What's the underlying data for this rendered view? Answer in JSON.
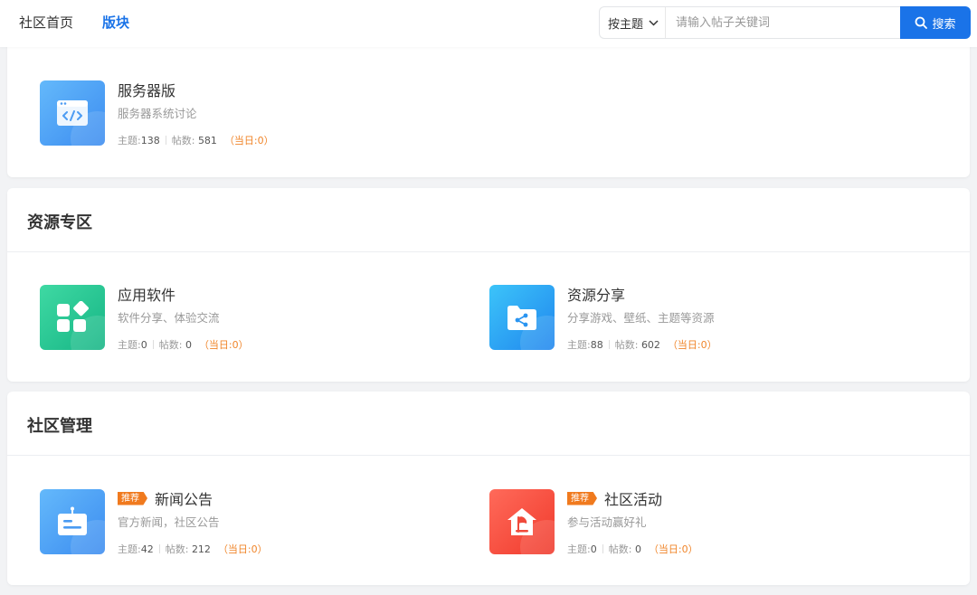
{
  "nav": {
    "home": "社区首页",
    "board": "版块"
  },
  "search": {
    "mode": "按主题",
    "placeholder": "请输入帖子关键词",
    "button": "搜索"
  },
  "labels": {
    "threads": "主题:",
    "posts": "帖数:",
    "today_open": "（当日:",
    "today_close": "）"
  },
  "colors": {
    "accent": "#1a73e8",
    "tag": "#f07a1e",
    "today": "#f0852a"
  },
  "sections": [
    {
      "title": "",
      "forums": [
        {
          "name": "服务器版",
          "desc": "服务器系统讨论",
          "threads": "138",
          "posts": "581",
          "today": "0",
          "tag": "",
          "icon": "code-window-icon"
        }
      ]
    },
    {
      "title": "资源专区",
      "forums": [
        {
          "name": "应用软件",
          "desc": "软件分享、体验交流",
          "threads": "0",
          "posts": "0",
          "today": "0",
          "tag": "",
          "icon": "apps-grid-icon"
        },
        {
          "name": "资源分享",
          "desc": "分享游戏、壁纸、主题等资源",
          "threads": "88",
          "posts": "602",
          "today": "0",
          "tag": "",
          "icon": "share-folder-icon"
        }
      ]
    },
    {
      "title": "社区管理",
      "forums": [
        {
          "name": "新闻公告",
          "desc": "官方新闻，社区公告",
          "threads": "42",
          "posts": "212",
          "today": "0",
          "tag": "推荐",
          "icon": "notice-board-icon"
        },
        {
          "name": "社区活动",
          "desc": "参与活动赢好礼",
          "threads": "0",
          "posts": "0",
          "today": "0",
          "tag": "推荐",
          "icon": "home-flag-icon"
        }
      ]
    }
  ]
}
